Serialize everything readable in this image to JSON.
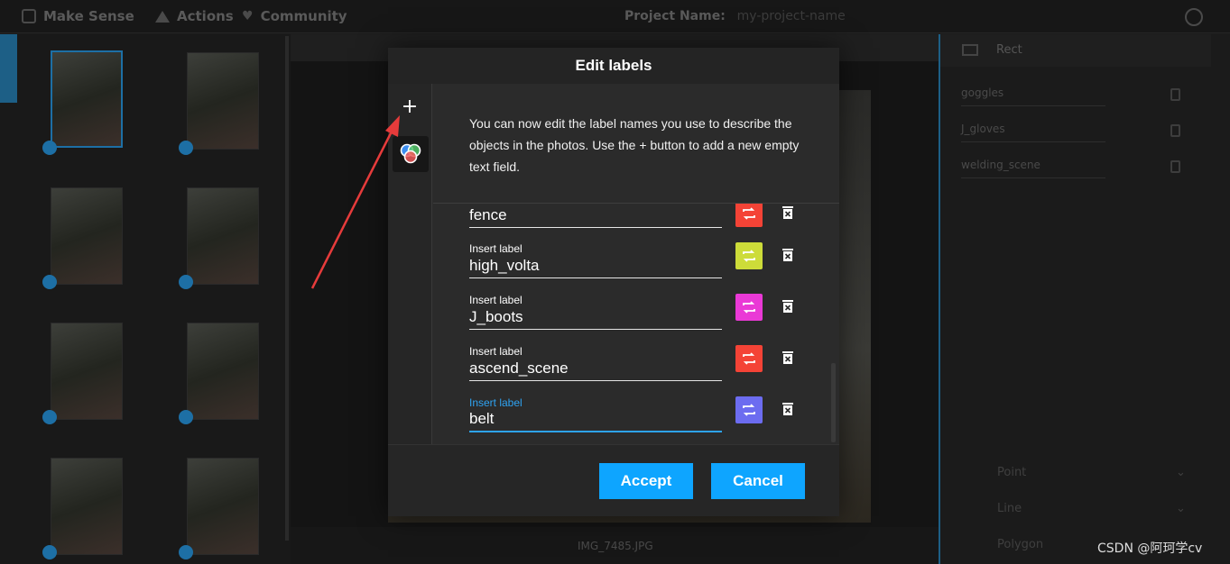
{
  "app": {
    "brand": "Make Sense",
    "menu_actions": "Actions",
    "menu_community": "Community",
    "project_name_label": "Project Name:",
    "project_name_value": "my-project-name",
    "current_image": "IMG_7485.JPG"
  },
  "right_panel": {
    "section_title": "Rect",
    "labels": [
      "goggles",
      "J_gloves",
      "welding_scene"
    ],
    "tools": [
      "Point",
      "Line",
      "Polygon"
    ]
  },
  "modal": {
    "title": "Edit labels",
    "description": "You can now edit the label names you use to describe the objects in the photos. Use the + button to add a new empty text field.",
    "add_button": "+",
    "label_caption": "Insert label",
    "rows": [
      {
        "value": "fence",
        "color": "#f44336"
      },
      {
        "value": "high_volta",
        "color": "#cddc39"
      },
      {
        "value": "J_boots",
        "color": "#ea39d6"
      },
      {
        "value": "ascend_scene",
        "color": "#f44336"
      },
      {
        "value": "belt",
        "color": "#6c6cf0"
      }
    ],
    "accept_label": "Accept",
    "cancel_label": "Cancel"
  },
  "colors": {
    "accent": "#0ea5ff",
    "focus": "#2ea3f2",
    "arrow": "#e63b3b"
  },
  "watermark": "CSDN @阿珂学cv"
}
